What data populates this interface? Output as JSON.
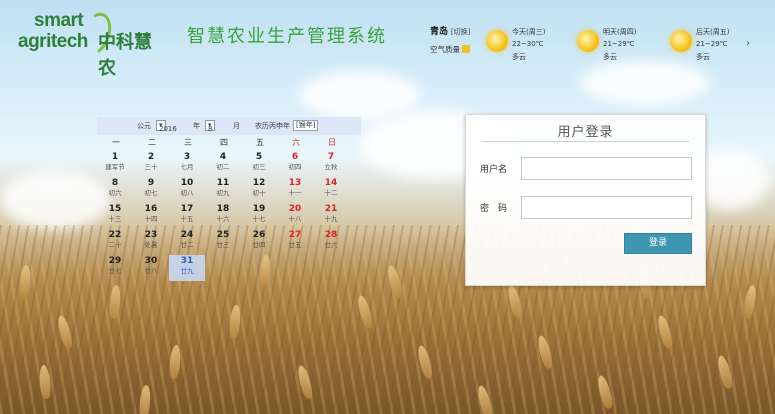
{
  "header": {
    "logo": {
      "line1": "smart",
      "line2": "agritech",
      "cn": "中科慧农"
    },
    "system_title": "智慧农业生产管理系统"
  },
  "weather": {
    "city": "青岛",
    "city_tag": "[切换]",
    "air_quality_label": "空气质量",
    "days": [
      {
        "title": "今天(周三)",
        "temp": "22~30℃",
        "desc": "多云",
        "icon": "sun-icon"
      },
      {
        "title": "明天(周四)",
        "temp": "21~29℃",
        "desc": "多云",
        "icon": "sun-icon"
      },
      {
        "title": "后天(周五)",
        "temp": "21~29℃",
        "desc": "多云",
        "icon": "sun-icon"
      }
    ],
    "next_icon": "›"
  },
  "calendar": {
    "era_label": "公元",
    "year": "2016",
    "year_label": "年",
    "month": "8",
    "month_label": "月",
    "lunar_year": "农历丙申年",
    "festival_label": "[猴年]",
    "weekdays": [
      "一",
      "二",
      "三",
      "四",
      "五",
      "六",
      "日"
    ],
    "rows": [
      [
        {
          "d": "1",
          "l": "建军节"
        },
        {
          "d": "2",
          "l": "三十"
        },
        {
          "d": "3",
          "l": "七月"
        },
        {
          "d": "4",
          "l": "初二"
        },
        {
          "d": "5",
          "l": "初三"
        },
        {
          "d": "6",
          "l": "初四"
        },
        {
          "d": "7",
          "l": "立秋"
        }
      ],
      [
        {
          "d": "8",
          "l": "初六"
        },
        {
          "d": "9",
          "l": "初七"
        },
        {
          "d": "10",
          "l": "初八"
        },
        {
          "d": "11",
          "l": "初九"
        },
        {
          "d": "12",
          "l": "初十"
        },
        {
          "d": "13",
          "l": "十一"
        },
        {
          "d": "14",
          "l": "十二"
        }
      ],
      [
        {
          "d": "15",
          "l": "十三"
        },
        {
          "d": "16",
          "l": "十四"
        },
        {
          "d": "17",
          "l": "十五"
        },
        {
          "d": "18",
          "l": "十六"
        },
        {
          "d": "19",
          "l": "十七"
        },
        {
          "d": "20",
          "l": "十八"
        },
        {
          "d": "21",
          "l": "十九"
        }
      ],
      [
        {
          "d": "22",
          "l": "二十"
        },
        {
          "d": "23",
          "l": "处暑"
        },
        {
          "d": "24",
          "l": "廿二"
        },
        {
          "d": "25",
          "l": "廿三"
        },
        {
          "d": "26",
          "l": "廿四"
        },
        {
          "d": "27",
          "l": "廿五"
        },
        {
          "d": "28",
          "l": "廿六"
        }
      ],
      [
        {
          "d": "29",
          "l": "廿七"
        },
        {
          "d": "30",
          "l": "廿八"
        },
        {
          "d": "31",
          "l": "廿九"
        }
      ]
    ],
    "today": "31"
  },
  "login": {
    "title": "用户登录",
    "username_label": "用户名",
    "password_label": "密　码",
    "username_value": "",
    "password_value": "",
    "submit_label": "登录"
  },
  "colors": {
    "title_green": "#3aa33b",
    "logo_green": "#2e7f3a",
    "button_blue": "#3e96b0",
    "weekend_red": "#d22222"
  }
}
